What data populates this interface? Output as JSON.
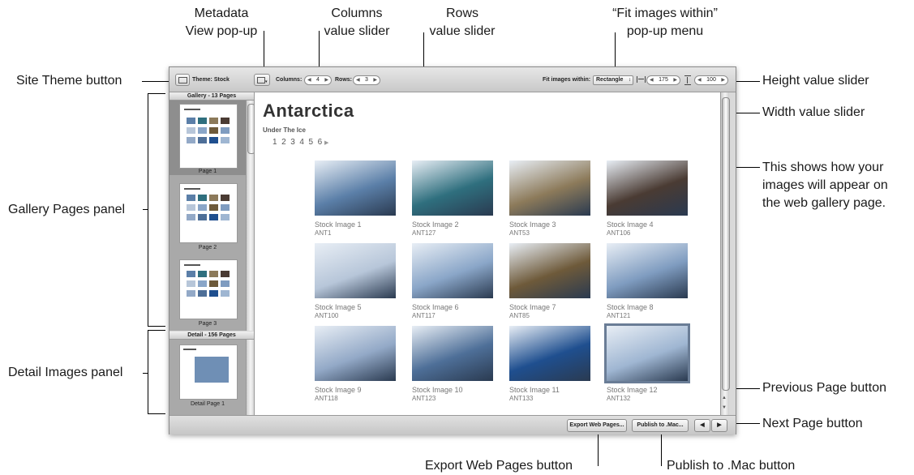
{
  "callouts": {
    "metadata_view": [
      "Metadata",
      "View pop-up"
    ],
    "columns_slider": [
      "Columns",
      "value slider"
    ],
    "rows_slider": [
      "Rows",
      "value slider"
    ],
    "fit_images": [
      "“Fit images within”",
      "pop-up menu"
    ],
    "site_theme": "Site Theme button",
    "height_slider": "Height value slider",
    "width_slider": "Width value slider",
    "shows_how": [
      "This shows how your",
      "images will appear on",
      "the web gallery page."
    ],
    "gallery_pages": "Gallery Pages panel",
    "detail_images": "Detail Images panel",
    "previous_page": "Previous Page button",
    "next_page": "Next Page button",
    "export_web": "Export Web Pages button",
    "publish_mac": "Publish to .Mac button"
  },
  "toolbar": {
    "theme_label": "Theme: Stock",
    "columns_label": "Columns:",
    "columns_value": "4",
    "rows_label": "Rows:",
    "rows_value": "3",
    "fit_label": "Fit images within:",
    "fit_value": "Rectangle",
    "width_value": "175",
    "height_value": "100"
  },
  "gallery_panel": {
    "header": "Gallery - 13 Pages",
    "pages": [
      "Page 1",
      "Page 2",
      "Page 3"
    ]
  },
  "detail_panel": {
    "header": "Detail - 156 Pages",
    "pages": [
      "Detail Page 1"
    ]
  },
  "main": {
    "title": "Antarctica",
    "subtitle": "Under The Ice",
    "pager": [
      "1",
      "2",
      "3",
      "4",
      "5",
      "6"
    ],
    "images": [
      {
        "name": "Stock Image 1",
        "code": "ANT1",
        "color": "#5b7fa8"
      },
      {
        "name": "Stock Image 2",
        "code": "ANT127",
        "color": "#2f6f7e"
      },
      {
        "name": "Stock Image 3",
        "code": "ANT53",
        "color": "#8c7a5a"
      },
      {
        "name": "Stock Image 4",
        "code": "ANT106",
        "color": "#4a3b33"
      },
      {
        "name": "Stock Image 5",
        "code": "ANT100",
        "color": "#b7c6d9"
      },
      {
        "name": "Stock Image 6",
        "code": "ANT117",
        "color": "#8aa6c8"
      },
      {
        "name": "Stock Image 7",
        "code": "ANT85",
        "color": "#6e5a3a"
      },
      {
        "name": "Stock Image 8",
        "code": "ANT121",
        "color": "#7f9cc0"
      },
      {
        "name": "Stock Image 9",
        "code": "ANT118",
        "color": "#93a9c7"
      },
      {
        "name": "Stock Image 10",
        "code": "ANT123",
        "color": "#4e6f98"
      },
      {
        "name": "Stock Image 11",
        "code": "ANT133",
        "color": "#1f4f8f"
      },
      {
        "name": "Stock Image 12",
        "code": "ANT132",
        "color": "#9fb6d2"
      }
    ]
  },
  "bottom": {
    "export_label": "Export Web Pages...",
    "publish_label": "Publish to .Mac..."
  }
}
